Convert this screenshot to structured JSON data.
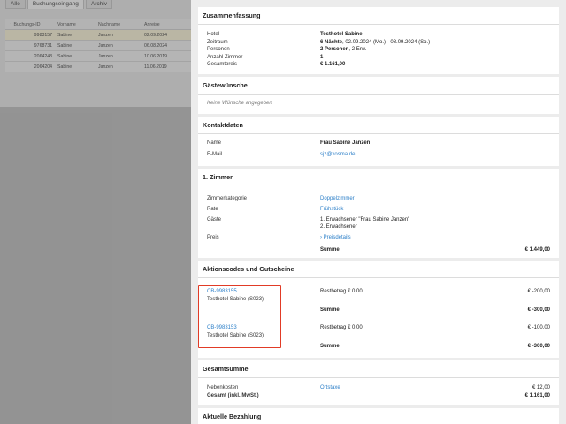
{
  "background": {
    "tabs": [
      {
        "label": "Alle"
      },
      {
        "label": "Buchungseingang"
      },
      {
        "label": "Archiv"
      }
    ],
    "columns": [
      "Buchungs-ID",
      "Vorname",
      "Nachname",
      "Anreise"
    ],
    "rows": [
      {
        "id": "9983157",
        "first": "Sabine",
        "last": "Janzen",
        "arrival": "02.09.2024"
      },
      {
        "id": "9768731",
        "first": "Sabine",
        "last": "Janzen",
        "arrival": "06.08.2024"
      },
      {
        "id": "2064243",
        "first": "Sabine",
        "last": "Janzen",
        "arrival": "10.06.2019"
      },
      {
        "id": "2064204",
        "first": "Sabine",
        "last": "Janzen",
        "arrival": "11.06.2019"
      }
    ]
  },
  "summary": {
    "title": "Zusammenfassung",
    "hotel_label": "Hotel",
    "hotel_value": "Testhotel Sabine",
    "period_label": "Zeitraum",
    "period_bold": "6 Nächte",
    "period_rest": ", 02.09.2024 (Mo.) - 08.09.2024 (So.)",
    "persons_label": "Personen",
    "persons_bold": "2 Personen",
    "persons_rest": ", 2 Erw.",
    "rooms_label": "Anzahl Zimmer",
    "rooms_value": "1",
    "total_label": "Gesamtpreis",
    "total_value": "€ 1.161,00"
  },
  "wishes": {
    "title": "Gästewünsche",
    "empty_text": "Keine Wünsche angegeben"
  },
  "contact": {
    "title": "Kontaktdaten",
    "name_label": "Name",
    "name_value": "Frau Sabine Janzen",
    "email_label": "E-Mail",
    "email_value": "sjz@xosma.de"
  },
  "room": {
    "title": "1. Zimmer",
    "category_label": "Zimmerkategorie",
    "category_value": "Doppelzimmer",
    "rate_label": "Rate",
    "rate_value": "Frühstück",
    "guests_label": "Gäste",
    "guest1": "1. Erwachsener \"Frau Sabine Janzen\"",
    "guest2": "2. Erwachsener",
    "price_label": "Preis",
    "price_link": "Preisdetails",
    "sum_label": "Summe",
    "sum_value": "€ 1.449,00"
  },
  "codes": {
    "title": "Aktionscodes und Gutscheine",
    "items": [
      {
        "code": "CB-9983155",
        "hotel": "Testhotel Sabine (S023)",
        "remaining": "Restbetrag € 0,00",
        "amount": "€ -200,00",
        "sum_label": "Summe",
        "sum_value": "€ -300,00"
      },
      {
        "code": "CB-9983153",
        "hotel": "Testhotel Sabine (S023)",
        "remaining": "Restbetrag € 0,00",
        "amount": "€ -100,00",
        "sum_label": "Summe",
        "sum_value": "€ -300,00"
      }
    ]
  },
  "total": {
    "title": "Gesamtsumme",
    "extra_label": "Nebenkosten",
    "extra_link": "Ortstaxe",
    "extra_value": "€ 12,00",
    "grand_label": "Gesamt (inkl. MwSt.)",
    "grand_value": "€ 1.161,00"
  },
  "payment": {
    "title": "Aktuelle Bezahlung"
  },
  "colors": {
    "link": "#2c7fc8",
    "highlight": "#e13b26"
  }
}
